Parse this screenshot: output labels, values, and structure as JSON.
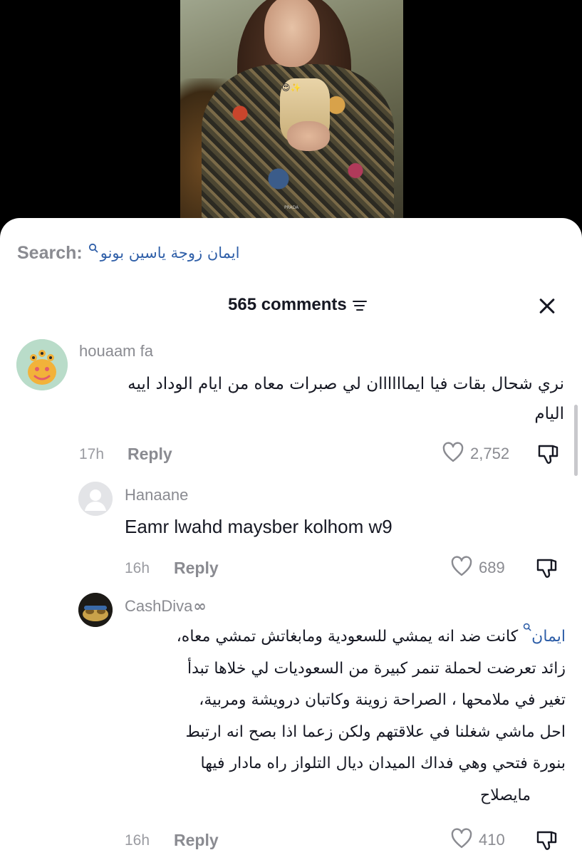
{
  "video": {
    "emoji": "😍✨",
    "watermark": "PRADA"
  },
  "search": {
    "label": "Search:",
    "query": "ايمان زوجة ياسين بونو"
  },
  "header": {
    "comments_count": "565 comments"
  },
  "comments": [
    {
      "username": "houaam fa",
      "lines": [
        "نري شحال بقات فيا ايماااااان لي صبرات معاه من ايام الوداد اييه",
        "اليام"
      ],
      "time": "17h",
      "reply_label": "Reply",
      "likes": "2,752"
    },
    {
      "username": "Hanaane",
      "text": "Eamr lwahd maysber kolhom w9",
      "time": "16h",
      "reply_label": "Reply",
      "likes": "689"
    },
    {
      "username": "CashDiva",
      "username_suffix": "∞",
      "mention": "ايمان",
      "lines": [
        "كانت ضد انه يمشي للسعودية ومابغاتش تمشي معاه،",
        "زائد تعرضت لحملة تنمر كبيرة من السعوديات لي خلاها تبدأ",
        "تغير في ملامحها ، الصراحة زوينة وكاتبان درويشة ومربية،",
        "احل ماشي شغلنا في علاقتهم ولكن زعما اذا بصح انه ارتبط",
        "بنورة فتحي وهي فداك الميدان ديال التلواز راه مادار فيها",
        "مايصلاح"
      ],
      "time": "16h",
      "reply_label": "Reply",
      "likes": "410"
    }
  ],
  "colors": {
    "accent_link": "#2f5fa8",
    "muted_text": "#8a8b91",
    "primary_text": "#161823"
  },
  "icons": [
    "search-q-icon",
    "filter-icon",
    "close-icon",
    "heart-icon",
    "dislike-icon"
  ]
}
